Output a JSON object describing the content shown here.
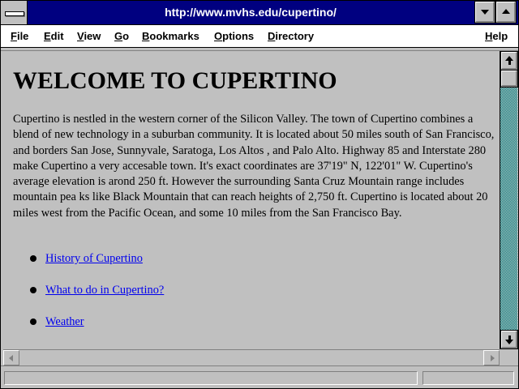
{
  "window": {
    "title": "http://www.mvhs.edu/cupertino/"
  },
  "menu": {
    "items": [
      "File",
      "Edit",
      "View",
      "Go",
      "Bookmarks",
      "Options",
      "Directory"
    ],
    "help": "Help"
  },
  "page": {
    "title": "WELCOME TO CUPERTINO",
    "intro": "Cupertino is nestled in the western corner of the Silicon Valley. The town of Cupertino combines a blend of new technology in a suburban community. It is located about 50 miles south of San Francisco, and borders San Jose, Sunnyvale, Saratoga, Los Altos , and Palo Alto. Highway 85 and Interstate 280 make Cupertino a very accesable town. It's exact coordinates are 37'19\" N, 122'01\" W. Cupertino's average elevation is arond 250 ft. However the surrounding Santa Cruz Mountain range includes mountain pea ks like Black Mountain that can reach heights of 2,750 ft. Cupertino is located about 20 miles west from the Pacific Ocean, and some 10 miles from the San Francisco Bay.",
    "links": [
      {
        "label": "History of Cupertino"
      },
      {
        "label": "What to do in Cupertino?"
      },
      {
        "label": "Weather"
      }
    ]
  },
  "status": {
    "text": ""
  },
  "colors": {
    "title_bar": "#000080",
    "link": "#0000ee",
    "scroll_track": "#008080",
    "background": "#c0c0c0"
  },
  "icons": {
    "system_menu": "system-menu-icon",
    "minimize": "minimize-icon",
    "maximize": "maximize-icon",
    "scroll_up": "arrow-up-icon",
    "scroll_down": "arrow-down-icon",
    "scroll_left": "arrow-left-icon",
    "scroll_right": "arrow-right-icon",
    "bullet": "bullet-icon"
  }
}
